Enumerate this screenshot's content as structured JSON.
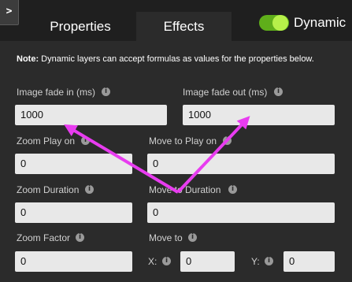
{
  "header": {
    "expander_label": ">",
    "tabs": [
      {
        "label": "Properties",
        "active": false
      },
      {
        "label": "Effects",
        "active": true
      }
    ],
    "dynamic_toggle": {
      "label": "Dynamic",
      "on": true
    }
  },
  "note": {
    "prefix": "Note:",
    "text": " Dynamic layers can accept formulas as values for the properties below."
  },
  "fields": {
    "image_fade_in": {
      "label": "Image fade in (ms)",
      "value": "1000"
    },
    "image_fade_out": {
      "label": "Image fade out (ms)",
      "value": "1000"
    },
    "zoom_play_on": {
      "label": "Zoom Play on",
      "value": "0"
    },
    "move_to_play_on": {
      "label": "Move to Play on",
      "value": "0"
    },
    "zoom_duration": {
      "label": "Zoom Duration",
      "value": "0"
    },
    "move_to_duration": {
      "label": "Move to Duration",
      "value": "0"
    },
    "zoom_factor": {
      "label": "Zoom Factor",
      "value": "0"
    },
    "move_to": {
      "label": "Move to",
      "x_label": "X:",
      "x_value": "0",
      "y_label": "Y:",
      "y_value": "0"
    }
  },
  "info_icon": "i",
  "colors": {
    "toggle_track": "#5fae1a",
    "toggle_knob": "#b6f04a",
    "annotation_arrow": "#e83cf0"
  }
}
